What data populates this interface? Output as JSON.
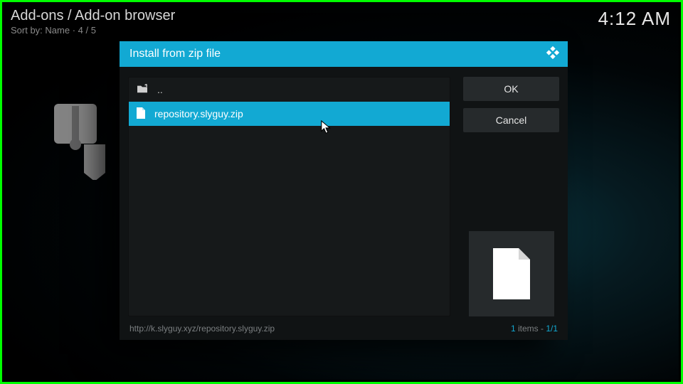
{
  "header": {
    "title": "Add-ons / Add-on browser",
    "sort_prefix": "Sort by: ",
    "sort_value": "Name",
    "sort_separator": "  ·  ",
    "page_indicator": "4 / 5",
    "clock": "4:12 AM"
  },
  "dialog": {
    "title": "Install from zip file",
    "buttons": {
      "ok": "OK",
      "cancel": "Cancel"
    },
    "rows": {
      "up_label": "..",
      "file_label": "repository.slyguy.zip"
    },
    "footer_path": "http://k.slyguy.xyz/repository.slyguy.zip",
    "footer_count_num": "1",
    "footer_count_word": " items - ",
    "footer_count_pos": "1/1"
  },
  "icons": {
    "kodi": "kodi-logo",
    "folder_up": "folder-up-icon",
    "file": "file-icon",
    "preview_file": "file-icon"
  }
}
